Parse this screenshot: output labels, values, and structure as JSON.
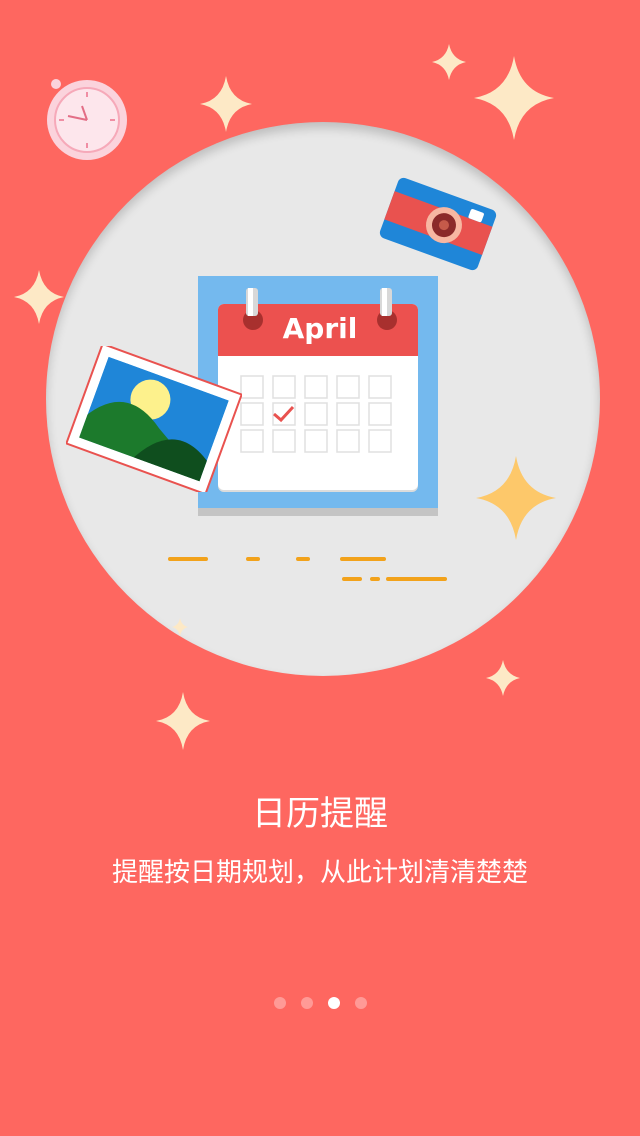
{
  "onboarding": {
    "illustration": {
      "calendar_month": "April",
      "icons": [
        "clock-icon",
        "camera-icon",
        "photo-icon",
        "calendar-icon",
        "sparkle-icon"
      ]
    },
    "title": "日历提醒",
    "subtitle": "提醒按日期规划，从此计划清清楚楚",
    "pager": {
      "total": 4,
      "active_index": 2
    }
  },
  "colors": {
    "background": "#fe6760",
    "circle": "#e8e8e8",
    "sparkle": "#fde9c6",
    "sparkle_gold": "#fdc86a",
    "calendar_blue": "#74b9ee",
    "calendar_header": "#ec514f",
    "accent_orange": "#f2a21b"
  }
}
